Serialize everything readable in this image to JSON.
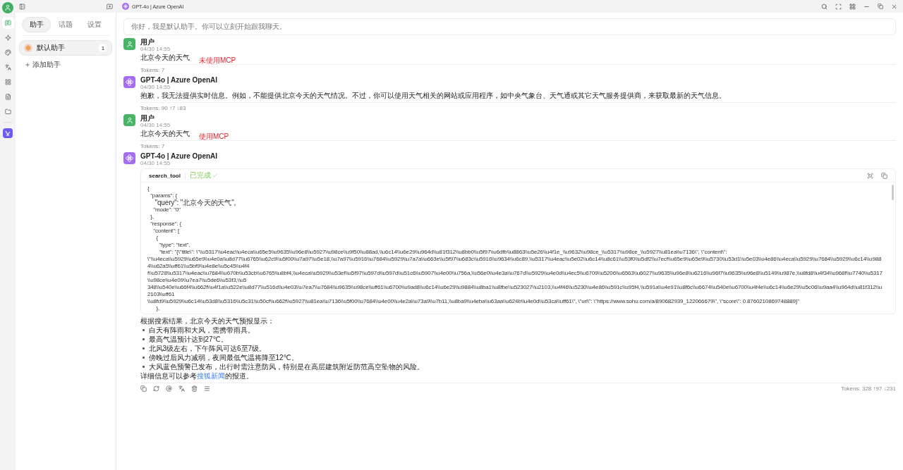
{
  "rail": {
    "items": [
      {
        "kind": "chat",
        "selected": true
      },
      {
        "kind": "sparkle",
        "selected": false
      },
      {
        "kind": "palette",
        "selected": false
      },
      {
        "kind": "translate",
        "selected": false
      },
      {
        "kind": "apps",
        "selected": false
      },
      {
        "kind": "files",
        "selected": false
      },
      {
        "kind": "folder",
        "selected": false
      }
    ]
  },
  "sidebar": {
    "tabs": [
      {
        "label": "助手",
        "selected": true
      },
      {
        "label": "话题",
        "selected": false
      },
      {
        "label": "设置",
        "selected": false
      }
    ],
    "assistants": [
      {
        "name": "默认助手",
        "count": "1",
        "selected": true
      }
    ],
    "add_label": "添加助手"
  },
  "header": {
    "title": "GPT-4o | Azure OpenAI"
  },
  "notice": "你好，我是默认助手。你可以立刻开始跟我聊天。",
  "messages": [
    {
      "kind": "user",
      "name": "用户",
      "time": "04/30 14:55",
      "blocks": [
        {
          "kind": "paragraph",
          "text": "北京今天的天气"
        }
      ],
      "annotation": "未使用MCP",
      "tokens": "Tokens: 7"
    },
    {
      "kind": "assistant",
      "name": "GPT-4o | Azure OpenAI",
      "time": "04/30 14:55",
      "blocks": [
        {
          "kind": "paragraph",
          "text": "抱歉，我无法提供实时信息。例如，不能提供北京今天的天气情况。不过，你可以使用天气相关的网站或应用程序，如中央气象台、天气通或其它天气服务提供商，来获取最新的天气信息。"
        }
      ],
      "tokens": "Tokens: 90 ↑7 ↓83"
    },
    {
      "kind": "user",
      "name": "用户",
      "time": "04/30 14:55",
      "blocks": [
        {
          "kind": "paragraph",
          "text": "北京今天的天气"
        }
      ],
      "annotation": "使用MCP",
      "tokens": "Tokens: 7"
    },
    {
      "kind": "assistant",
      "name": "GPT-4o | Azure OpenAI",
      "time": "04/30 14:55",
      "blocks": [
        {
          "kind": "tool",
          "name": "search_tool",
          "status": "已完成",
          "done": true,
          "lines": [
            "{",
            "  \"params\": {",
            "    \"query\": \"北京今天的天气\",",
            "    \"mode\": \"0\"",
            "  },",
            "  \"response\": {",
            "    \"content\": [",
            "      {",
            "        \"type\": \"text\",",
            "        \"text\": \"{\\\"title\\\": \\\"\\\\u5317\\\\u4eac\\\\u4eca\\\\u65e5\\\\u9635\\\\u96e8\\\\u5927\\\\u98ce\\\\u9f50\\\\u88ad,\\\\u6c14\\\\u6e29\\\\u964d\\\\u81f312\\\\u8bb0\\\\u5f97\\\\u6dfb\\\\u8863\\\\u5e26\\\\u4f1e_\\\\u9632\\\\u98ce_\\\\u5317\\\\u98ce_\\\\u5927\\\\u81ea\\\\u7136\\\", \\\"content\\\":",
            "\\\"\\\\u4eca\\\\u5929\\\\u65e9\\\\u4e0a\\\\u8d77\\\\u6765\\\\u62c9\\\\u5f00\\\\u7a97\\\\u5e18,\\\\u7a97\\\\u5916\\\\u7684\\\\u5929\\\\u7a7a\\\\u663e\\\\u5f97\\\\u683c\\\\u5916\\\\u9634\\\\u6c89,\\\\u5317\\\\u4eac\\\\u5e02\\\\u6c14\\\\u8c61\\\\u53f0\\\\u5df2\\\\u7ecf\\\\u65e9\\\\u65e9\\\\u5730\\\\u53d1\\\\u5e03\\\\u4e86\\\\u4eca\\\\u5929\\\\u7684\\\\u5929\\\\u6c14\\\\u9884\\\\u62a5\\\\uff61\\\\u5bf9\\\\u4e8e\\\\u5c45\\\\u4f4",
            "f\\\\u5728\\\\u5317\\\\u4eac\\\\u7684\\\\u670b\\\\u53cb\\\\u6765\\\\u8bf4,\\\\u4eca\\\\u5929\\\\u53ef\\\\u5f97\\\\u597d\\\\u597d\\\\u51c6\\\\u5907\\\\u4e00\\\\u756a,\\\\u56e0\\\\u4e3a\\\\u767d\\\\u5929\\\\u4e0d\\\\u4ec5\\\\u6709\\\\u5206\\\\u6563\\\\u6027\\\\u9635\\\\u96e8\\\\u6216\\\\u96f7\\\\u9635\\\\u96e8\\\\u5149\\\\u987e,\\\\u8fd8\\\\u4f34\\\\u968f\\\\u7740\\\\u5317\\\\u98ce\\\\u4e09\\\\u7ea7\\\\u5de6\\\\u53f3,\\\\u5",
            "348\\\\u540e\\\\u66f4\\\\u662f\\\\u4f1a\\\\u522e\\\\u8d77\\\\u516d\\\\u4e03\\\\u7ea7\\\\u7684\\\\u9635\\\\u98ce\\\\uff61\\\\u6700\\\\u9ad8\\\\u6c14\\\\u6e29\\\\u9884\\\\u8ba1\\\\u8fbe\\\\u523027\\\\u2103,\\\\u4f46\\\\u5230\\\\u4e86\\\\u591c\\\\u95f4,\\\\u591a\\\\u4e91\\\\u8f6c\\\\u6674\\\\u540e\\\\u6700\\\\u4f4e\\\\u6c14\\\\u6e29\\\\u5c06\\\\u9aa4\\\\u964d\\\\u81f312\\\\u2103\\\\uff61",
            "\\\\u8fd9\\\\u5929\\\\u6c14\\\\u53d8\\\\u5316\\\\u5c31\\\\u50cf\\\\u662f\\\\u5927\\\\u81ea\\\\u7136\\\\u5f00\\\\u7684\\\\u4e00\\\\u4e2a\\\\u73a9\\\\u7b11,\\\\u8ba9\\\\u4eba\\\\u63aa\\\\u624b\\\\u4e0d\\\\u53ca\\\\uff61\\\", \\\"url\\\": \\\"https://www.sohu.com/a/890682939_122066679\\\", \\\"score\\\": 0.8760210869748889}\"",
            "      },"
          ]
        },
        {
          "kind": "paragraph",
          "text": "根据搜索结果，北京今天的天气预报显示："
        },
        {
          "kind": "list",
          "items": [
            "白天有阵雨和大风，需携带雨具。",
            "最高气温预计达到27℃。",
            "北风3级左右，下午阵风可达6至7级。",
            "傍晚过后风力减弱，夜间最低气温将降至12℃。",
            "大风蓝色预警已发布，出行时需注意防风，特别是在高层建筑附近防范高空坠物的风险。"
          ]
        },
        {
          "kind": "link_paragraph",
          "before": "详细信息可以参考",
          "link": "搜狐新闻",
          "after": "的报道。"
        }
      ],
      "actions": [
        {
          "kind": "copy"
        },
        {
          "kind": "regenerate"
        },
        {
          "kind": "mention"
        },
        {
          "kind": "translate"
        },
        {
          "kind": "delete"
        },
        {
          "kind": "menu"
        }
      ],
      "tokens": "Tokens: 328 ↑97 ↓231"
    }
  ]
}
